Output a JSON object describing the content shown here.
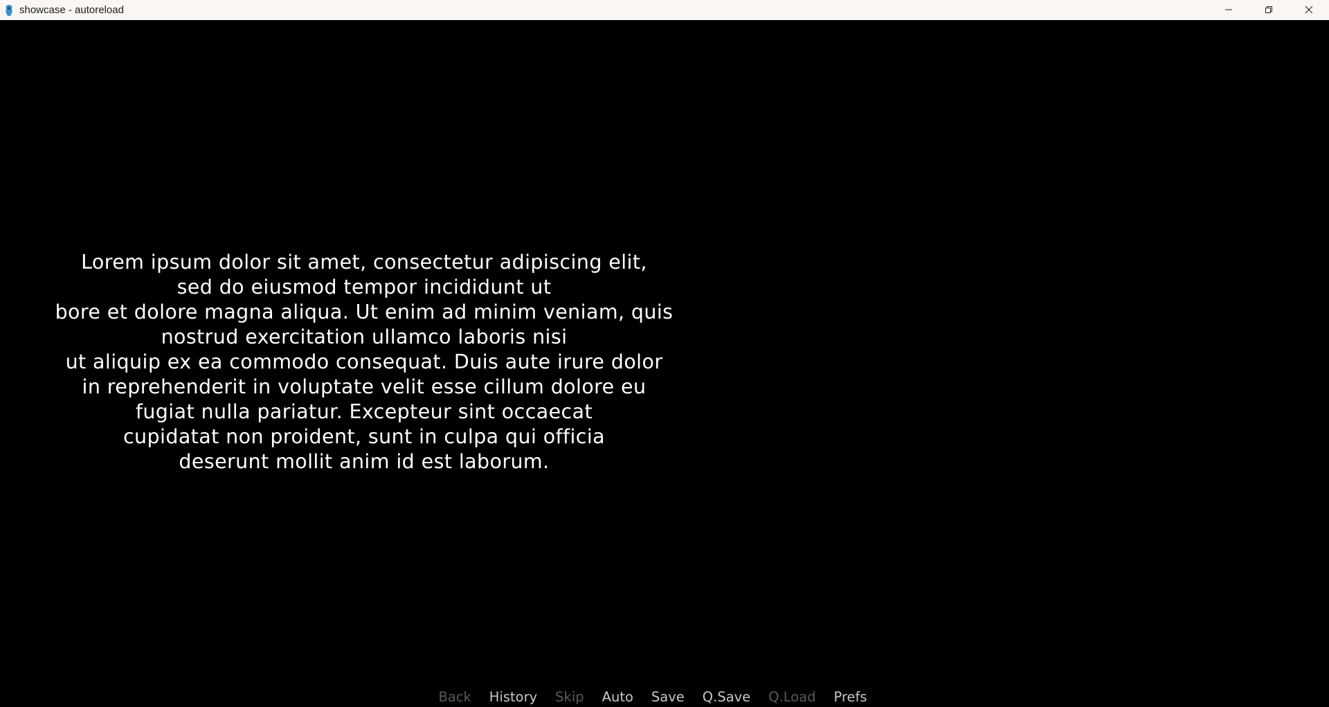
{
  "window": {
    "title": "showcase - autoreload"
  },
  "dialogue": {
    "lines": [
      "Lorem ipsum dolor sit amet, consectetur adipiscing elit,",
      "sed do eiusmod tempor incididunt ut",
      "bore et dolore magna aliqua. Ut enim ad minim veniam, quis",
      "nostrud exercitation ullamco laboris nisi",
      "ut aliquip ex ea commodo consequat. Duis aute irure dolor",
      "in reprehenderit in voluptate velit esse cillum dolore eu",
      "fugiat nulla pariatur. Excepteur sint occaecat",
      "cupidatat non proident, sunt in culpa qui officia",
      "deserunt mollit anim id est laborum."
    ]
  },
  "quick_menu": {
    "back": "Back",
    "history": "History",
    "skip": "Skip",
    "auto": "Auto",
    "save": "Save",
    "qsave": "Q.Save",
    "qload": "Q.Load",
    "prefs": "Prefs"
  },
  "icons": {
    "app": "renpy-icon",
    "minimize": "minimize-icon",
    "restore": "restore-icon",
    "close": "close-icon"
  },
  "colors": {
    "enabled": "#c8c8c8",
    "disabled": "#5a5a5a",
    "text": "#ffffff",
    "background": "#000000"
  }
}
